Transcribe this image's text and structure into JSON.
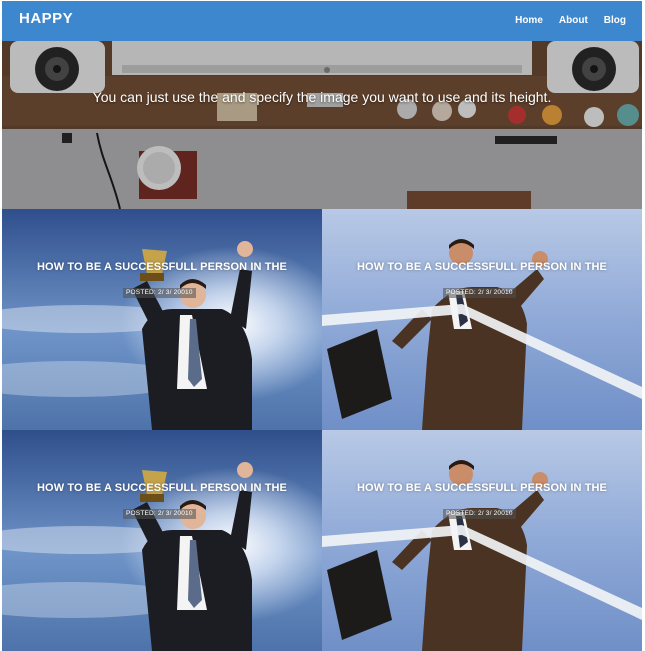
{
  "navbar": {
    "brand": "HAPPY",
    "links": [
      "Home",
      "About",
      "Blog"
    ]
  },
  "hero": {
    "text": "You can just use the and specify the image you want to use and its height."
  },
  "posts": [
    {
      "title": "HOW TO BE A SUCCESSFULL PERSON IN THE",
      "meta": "POSTED: 2/ 3/ 20010"
    },
    {
      "title": "HOW TO BE A SUCCESSFULL PERSON IN THE",
      "meta": "POSTED: 2/ 3/ 20010"
    },
    {
      "title": "HOW TO BE A SUCCESSFULL PERSON IN THE",
      "meta": "POSTED: 2/ 3/ 20010"
    },
    {
      "title": "HOW TO BE A SUCCESSFULL PERSON IN THE",
      "meta": "POSTED: 2/ 3/ 20010"
    }
  ],
  "colors": {
    "navbar": "#3d87cf",
    "text": "#ffffff"
  }
}
